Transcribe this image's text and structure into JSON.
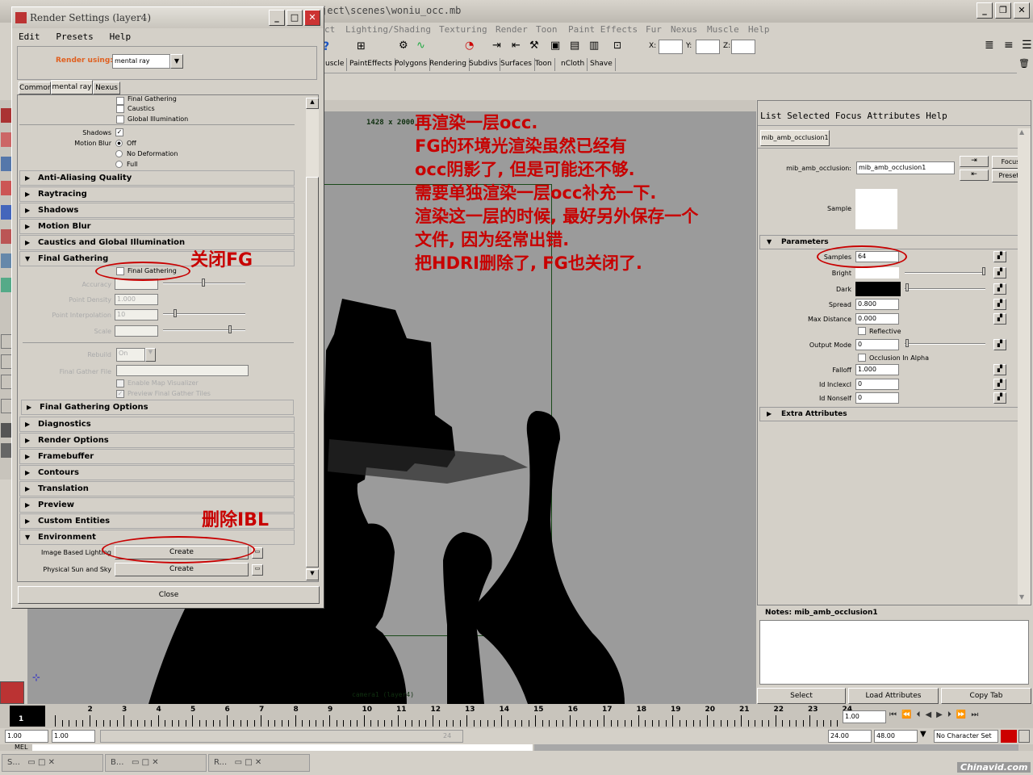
{
  "main": {
    "title": "ject\\scenes\\woniu_occ.mb",
    "menu": [
      "ct",
      "Lighting/Shading",
      "Texturing",
      "Render",
      "Toon",
      "Paint Effects",
      "Fur",
      "Nexus",
      "Muscle",
      "Help"
    ],
    "xyz": [
      "X:",
      "Y:",
      "Z:"
    ],
    "shelf_tabs": [
      "uscle",
      "PaintEffects",
      "Polygons",
      "Rendering",
      "Subdivs",
      "Surfaces",
      "Toon",
      "nCloth",
      "Shave"
    ]
  },
  "viewport": {
    "resolution": "1428 x 2000",
    "camera": "camera1 (layer4)"
  },
  "render_settings": {
    "title": "Render Settings (layer4)",
    "menu": [
      "Edit",
      "Presets",
      "Help"
    ],
    "render_using_label": "Render using:",
    "render_using_value": "mental ray",
    "tabs": [
      "Common",
      "mental ray",
      "Nexus"
    ],
    "top_checks": [
      "Final Gathering",
      "Caustics",
      "Global Illumination"
    ],
    "shadows_label": "Shadows",
    "motion_blur_label": "Motion Blur",
    "motion_blur_options": [
      "Off",
      "No Deformation",
      "Full"
    ],
    "sections_a": [
      "Anti-Aliasing Quality",
      "Raytracing",
      "Shadows",
      "Motion Blur",
      "Caustics and Global Illumination"
    ],
    "fg_section": "Final Gathering",
    "fg_check_label": "Final Gathering",
    "fg_fields": [
      {
        "label": "Accuracy",
        "value": ""
      },
      {
        "label": "Point Density",
        "value": "1.000"
      },
      {
        "label": "Point Interpolation",
        "value": "10"
      },
      {
        "label": "Scale",
        "value": ""
      }
    ],
    "rebuild_label": "Rebuild",
    "rebuild_value": "On",
    "fg_file_label": "Final Gather File",
    "enable_map_vis": "Enable Map Visualizer",
    "preview_fg_tiles": "Preview Final Gather Tiles",
    "fg_options": "Final Gathering Options",
    "sections_b": [
      "Diagnostics",
      "Render Options",
      "Framebuffer",
      "Contours",
      "Translation",
      "Preview",
      "Custom Entities"
    ],
    "env_section": "Environment",
    "ibl_label": "Image Based Lighting",
    "sun_sky_label": "Physical Sun and Sky",
    "create_label": "Create",
    "close_label": "Close"
  },
  "annotations": {
    "main": [
      "再渲染一层occ.",
      "FG的环境光渲染虽然已经有",
      "occ阴影了, 但是可能还不够.",
      "需要单独渲染一层occ补充一下.",
      "渲染这一层的时候, 最好另外保存一个",
      "文件, 因为经常出错.",
      "把HDRI删除了, FG也关闭了."
    ],
    "fg_close": "关闭FG",
    "delete_ibl": "删除IBL"
  },
  "attribute_editor": {
    "menu": "List  Selected  Focus  Attributes  Help",
    "tab": "mib_amb_occlusion1",
    "node_label": "mib_amb_occlusion:",
    "node_value": "mib_amb_occlusion1",
    "focus": "Focus",
    "presets": "Presets",
    "sample_label": "Sample",
    "parameters": "Parameters",
    "samples_label": "Samples",
    "samples_value": "64",
    "bright_label": "Bright",
    "dark_label": "Dark",
    "spread_label": "Spread",
    "spread_value": "0.800",
    "max_distance_label": "Max Distance",
    "max_distance_value": "0.000",
    "reflective_label": "Reflective",
    "output_mode_label": "Output Mode",
    "output_mode_value": "0",
    "occ_alpha_label": "Occlusion In Alpha",
    "falloff_label": "Falloff",
    "falloff_value": "1.000",
    "id_inclexcl_label": "Id Inclexcl",
    "id_inclexcl_value": "0",
    "id_nonself_label": "Id Nonself",
    "id_nonself_value": "0",
    "extra_attributes": "Extra Attributes",
    "notes_label": "Notes:  mib_amb_occlusion1",
    "select": "Select",
    "load_attributes": "Load Attributes",
    "copy_tab": "Copy Tab"
  },
  "timeline": {
    "ticks": [
      "1",
      "2",
      "3",
      "4",
      "5",
      "6",
      "7",
      "8",
      "9",
      "10",
      "11",
      "12",
      "13",
      "14",
      "15",
      "16",
      "17",
      "18",
      "19",
      "20",
      "21",
      "22",
      "23",
      "24"
    ],
    "current_frame": "1.00",
    "range_start": "1.00",
    "range_start2": "1.00",
    "range_thumb": "24",
    "range_end": "24.00",
    "range_end2": "48.00",
    "character_set": "No Character Set",
    "mel": "MEL"
  },
  "taskbar": {
    "items": [
      "S...",
      "B...",
      "R..."
    ],
    "watermark": "Chinavid.com"
  }
}
